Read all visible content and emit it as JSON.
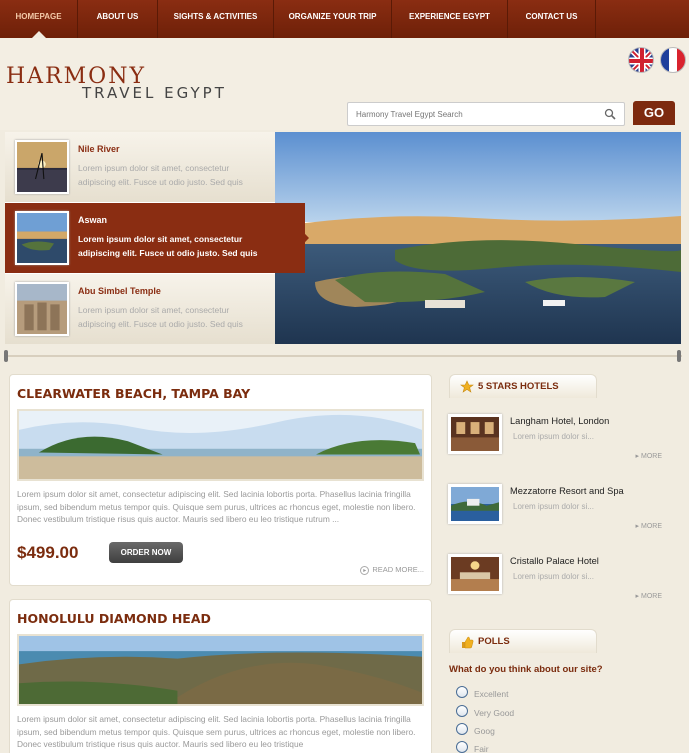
{
  "nav": [
    {
      "label": "Homepage",
      "active": true
    },
    {
      "label": "About us"
    },
    {
      "label": "Sights & Activities"
    },
    {
      "label": "Organize your trip"
    },
    {
      "label": "Experience Egypt"
    },
    {
      "label": "Contact us"
    }
  ],
  "header": {
    "logo_line1": "Harmony",
    "logo_line2": "Travel Egypt",
    "search_placeholder": "Harmony Travel Egypt Search",
    "go_label": "GO",
    "languages": [
      "english-flag-icon",
      "french-flag-icon"
    ]
  },
  "slider": {
    "items": [
      {
        "title": "Nile River",
        "desc": "Lorem ipsum dolor sit amet, consectetur adipiscing elit. Fusce ut odio justo. Sed quis"
      },
      {
        "title": "Aswan",
        "desc": "Lorem ipsum dolor sit amet, consectetur adipiscing elit. Fusce ut odio justo. Sed quis",
        "active": true
      },
      {
        "title": "Abu Simbel Temple",
        "desc": "Lorem ipsum dolor sit amet, consectetur adipiscing elit. Fusce ut odio justo. Sed quis"
      }
    ]
  },
  "cards": [
    {
      "title": "Clearwater Beach, Tampa Bay",
      "text": "Lorem ipsum dolor sit amet, consectetur adipiscing elit. Sed lacinia lobortis porta. Phasellus lacinia fringilla ipsum, sed bibendum metus tempor quis. Quisque sem purus, ultrices ac rhoncus eget, molestie non libero. Donec vestibulum tristique risus quis auctor. Mauris sed libero eu leo tristique rutrum ...",
      "price": "$499.00",
      "order_label": "Order now",
      "readmore_label": "Read more..."
    },
    {
      "title": "Honolulu Diamond Head",
      "text": "Lorem ipsum dolor sit amet, consectetur adipiscing elit. Sed lacinia lobortis porta. Phasellus lacinia fringilla ipsum, sed bibendum metus tempor quis. Quisque sem purus, ultrices ac rhoncus eget, molestie non libero. Donec vestibulum tristique risus quis auctor. Mauris sed libero eu leo tristique"
    }
  ],
  "hotels_section": {
    "title": "5 Stars Hotels",
    "items": [
      {
        "name": "Langham Hotel, London",
        "text": "Lorem ipsum dolor si...",
        "more": "More"
      },
      {
        "name": "Mezzatorre Resort and Spa",
        "text": "Lorem ipsum dolor si...",
        "more": "More"
      },
      {
        "name": "Cristallo Palace Hotel",
        "text": "Lorem ipsum dolor si...",
        "more": "More"
      }
    ]
  },
  "polls": {
    "title": "Polls",
    "question": "What do you think about our site?",
    "options": [
      "Excellent",
      "Very Good",
      "Goog",
      "Fair"
    ]
  },
  "colors": {
    "brand": "#8a2d12",
    "accent_text": "#7b2c0e",
    "background": "#f1ece0"
  }
}
